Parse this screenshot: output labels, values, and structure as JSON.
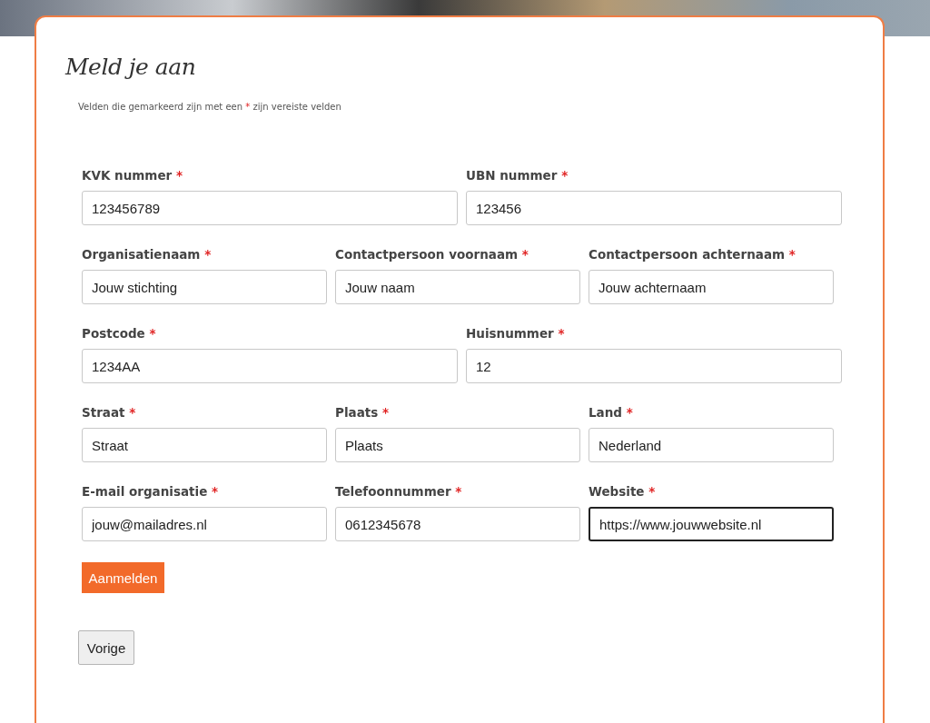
{
  "title": "Meld je aan",
  "note": {
    "before": "Velden die gemarkeerd zijn met een",
    "mark": "*",
    "after": "zijn vereiste velden"
  },
  "rows": [
    {
      "fields": [
        {
          "label": "KVK nummer",
          "mark": "*",
          "value": "123456789",
          "focused": false
        },
        {
          "label": "UBN nummer",
          "mark": "*",
          "value": "123456",
          "focused": false
        }
      ]
    },
    {
      "fields": [
        {
          "label": "Organisatienaam",
          "mark": "*",
          "value": "Jouw stichting",
          "focused": false
        },
        {
          "label": "Contactpersoon voornaam",
          "mark": "*",
          "value": "Jouw naam",
          "focused": false
        },
        {
          "label": "Contactpersoon achternaam",
          "mark": "*",
          "value": "Jouw achternaam",
          "focused": false
        }
      ]
    },
    {
      "fields": [
        {
          "label": "Postcode",
          "mark": "*",
          "value": "1234AA",
          "focused": false
        },
        {
          "label": "Huisnummer",
          "mark": "*",
          "value": "12",
          "focused": false
        }
      ]
    },
    {
      "fields": [
        {
          "label": "Straat",
          "mark": "*",
          "value": "Straat",
          "focused": false
        },
        {
          "label": "Plaats",
          "mark": "*",
          "value": "Plaats",
          "focused": false
        },
        {
          "label": "Land",
          "mark": "*",
          "value": "Nederland",
          "focused": false
        }
      ]
    },
    {
      "fields": [
        {
          "label": "E-mail organisatie",
          "mark": "*",
          "value": "jouw@mailadres.nl",
          "focused": false
        },
        {
          "label": "Telefoonnummer",
          "mark": "*",
          "value": "0612345678",
          "focused": false
        },
        {
          "label": "Website",
          "mark": "*",
          "value": "https://www.jouwwebsite.nl",
          "focused": true
        }
      ]
    }
  ],
  "submit": "Aanmelden",
  "back": "Vorige"
}
